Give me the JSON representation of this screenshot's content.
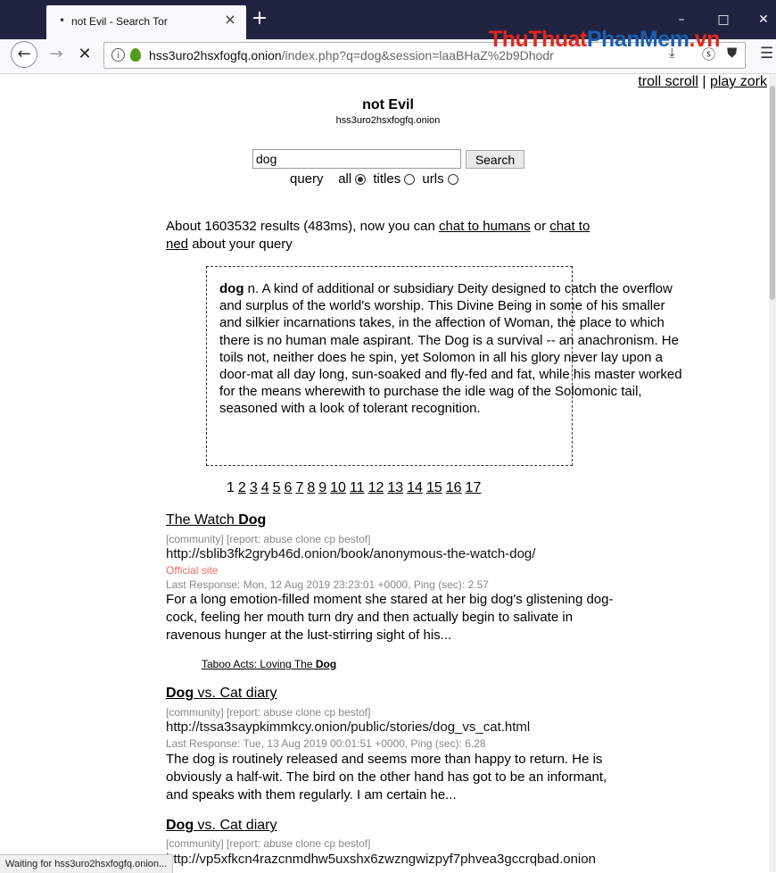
{
  "browser": {
    "tab_title": "not Evil - Search Tor",
    "tab_close": "×",
    "new_tab": "+",
    "window_controls": {
      "minimize": "–",
      "maximize": "□",
      "close": "✕"
    },
    "url_host": "hss3uro2hsxfogfq.onion",
    "url_path": "/index.php?q=dog&session=laaBHaZ%2b9Dhodr",
    "watermark_a": "ThuThuat",
    "watermark_b": "PhanMem",
    "watermark_c": ".vn",
    "status_text": "Waiting for hss3uro2hsxfogfq.onion..."
  },
  "toplinks": {
    "troll": "troll scroll",
    "sep": "|",
    "zork": "play zork"
  },
  "site": {
    "title": "not Evil",
    "subtitle": "hss3uro2hsxfogfq.onion"
  },
  "search": {
    "value": "dog",
    "button": "Search",
    "query_label": "query",
    "opt_all": "all",
    "opt_titles": "titles",
    "opt_urls": "urls",
    "selected": "all"
  },
  "about": {
    "prefix": "About 1603532 results (483ms), now you can",
    "chat_humans": "chat to humans",
    "or": "or",
    "chat_ned": "chat to ned",
    "suffix": "about your query"
  },
  "definition": {
    "term": "dog",
    "text": "n. A kind of additional or subsidiary Deity designed to catch the overflow and surplus of the world's worship. This Divine Being in some of his smaller and silkier incarnations takes, in the affection of Woman, the place to which there is no human male aspirant. The Dog is a survival -- an anachronism. He toils not, neither does he spin, yet Solomon in all his glory never lay upon a door-mat all day long, sun-soaked and fly-fed and fat, while his master worked for the means wherewith to purchase the idle wag of the Solomonic tail, seasoned with a look of tolerant recognition."
  },
  "pagination": {
    "current": "1",
    "pages": [
      "2",
      "3",
      "4",
      "5",
      "6",
      "7",
      "8",
      "9",
      "10",
      "11",
      "12",
      "13",
      "14",
      "15",
      "16",
      "17"
    ]
  },
  "results": [
    {
      "title_pre": "The Watch ",
      "title_bold": "Dog",
      "title_post": "",
      "meta": "[community] [report: abuse clone cp bestof]",
      "url": "http://sblib3fk2gryb46d.onion/book/anonymous-the-watch-dog/",
      "official": "Official site",
      "response": "Last Response: Mon, 12 Aug 2019 23:23:01 +0000, Ping (sec): 2.57",
      "snippet": "For a long emotion-filled moment she stared at her big dog's glistening dog-cock, feeling her mouth turn dry and then actually begin to salivate in ravenous hunger at the lust-stirring sight of his...",
      "sub_link_pre": "Taboo Acts: Loving The ",
      "sub_link_bold": "Dog"
    },
    {
      "title_pre": "",
      "title_bold": "Dog",
      "title_post": " vs. Cat diary",
      "meta": "[community] [report: abuse clone cp bestof]",
      "url": "http://tssa3saypkimmkcy.onion/public/stories/dog_vs_cat.html",
      "response": "Last Response: Tue, 13 Aug 2019 00:01:51 +0000, Ping (sec): 6.28",
      "snippet": "The dog is routinely released and seems more than happy to return. He is obviously a half-wit. The bird on the other hand has got to be an informant, and speaks with them regularly. I am certain he..."
    },
    {
      "title_pre": "",
      "title_bold": "Dog",
      "title_post": " vs. Cat diary",
      "meta": "[community] [report: abuse clone cp bestof]",
      "url": "http://vp5xfkcn4razcnmdhw5uxshx6zwzngwizpyf7phvea3gccrqbad.onion"
    }
  ]
}
